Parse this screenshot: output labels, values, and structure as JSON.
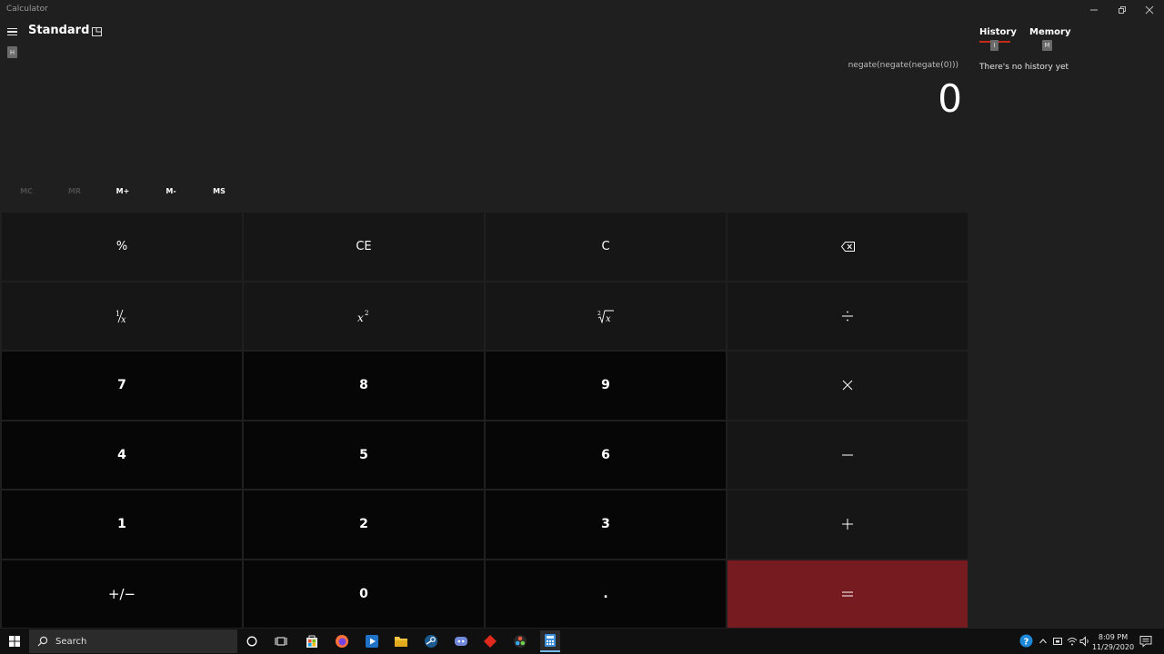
{
  "window": {
    "title": "Calculator"
  },
  "header": {
    "mode": "Standard"
  },
  "keyhints": {
    "hamburger": "H",
    "history": "I",
    "memory": "M"
  },
  "display": {
    "expression": "negate(negate(negate(0)))",
    "value": "0"
  },
  "memory_row": [
    "MC",
    "MR",
    "M+",
    "M-",
    "MS"
  ],
  "keys": {
    "percent": "%",
    "ce": "CE",
    "c": "C",
    "seven": "7",
    "eight": "8",
    "nine": "9",
    "four": "4",
    "five": "5",
    "six": "6",
    "one": "1",
    "two": "2",
    "three": "3",
    "zero": "0",
    "decimal": ".",
    "plus_minus": "+/−"
  },
  "panel": {
    "history_tab": "History",
    "memory_tab": "Memory",
    "empty_message": "There's no history yet"
  },
  "taskbar": {
    "search_placeholder": "Search",
    "time": "8:09 PM",
    "date": "11/29/2020"
  },
  "colors": {
    "equals": "#761c21",
    "accent": "#c42b1c"
  }
}
